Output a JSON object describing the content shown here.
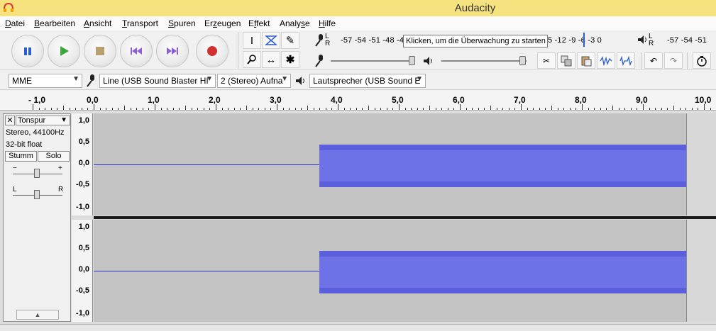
{
  "window": {
    "title": "Audacity"
  },
  "menu": [
    {
      "pre": "",
      "ul": "D",
      "post": "atei"
    },
    {
      "pre": "",
      "ul": "B",
      "post": "earbeiten"
    },
    {
      "pre": "",
      "ul": "A",
      "post": "nsicht"
    },
    {
      "pre": "",
      "ul": "T",
      "post": "ransport"
    },
    {
      "pre": "",
      "ul": "S",
      "post": "puren"
    },
    {
      "pre": "Er",
      "ul": "z",
      "post": "eugen"
    },
    {
      "pre": "E",
      "ul": "f",
      "post": "fekt"
    },
    {
      "pre": "Analy",
      "ul": "s",
      "post": "e"
    },
    {
      "pre": "",
      "ul": "H",
      "post": "ilfe"
    }
  ],
  "meters": {
    "record_scale": "-57 -54 -51 -48 -4",
    "record_scale_right": "5 -12  -9  -6  -3  0",
    "play_scale": "-57 -54 -51",
    "lr_top": "L",
    "lr_bottom": "R",
    "tooltip": "Klicken, um die Überwachung zu starten"
  },
  "devices": {
    "host": "MME",
    "input": "Line (USB Sound Blaster HI",
    "channels": "2 (Stereo) Aufna",
    "output": "Lautsprecher (USB Sound E"
  },
  "ruler": {
    "ticks": [
      "- 1,0",
      "0,0",
      "1,0",
      "2,0",
      "3,0",
      "4,0",
      "5,0",
      "6,0",
      "7,0",
      "8,0",
      "9,0",
      "10,0"
    ]
  },
  "track": {
    "name": "Tonspur",
    "info1": "Stereo, 44100Hz",
    "info2": "32-bit float",
    "mute": "Stumm",
    "solo": "Solo",
    "gain_minus": "−",
    "gain_plus": "+",
    "pan_left": "L",
    "pan_right": "R",
    "axis": [
      "1,0",
      "0,5",
      "0,0",
      "-0,5",
      "-1,0"
    ]
  },
  "colors": {
    "waveform": "#5b5fdc",
    "titlebar": "#f6e27e"
  }
}
